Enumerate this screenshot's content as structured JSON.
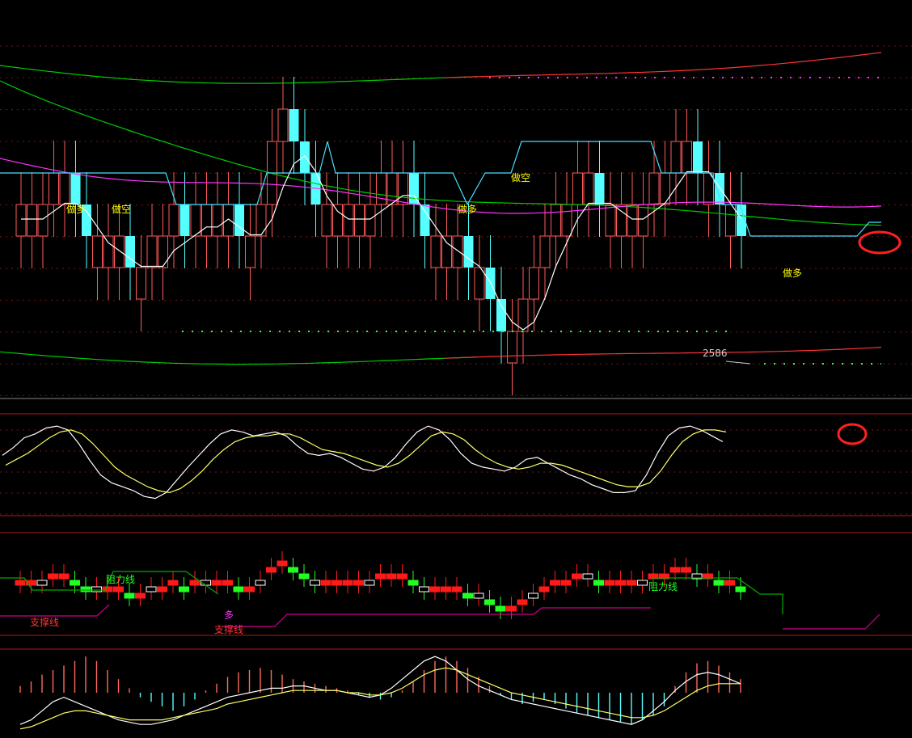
{
  "chart_data": [
    {
      "type": "candlestick",
      "panel": "main",
      "colors": {
        "up": "#ff5a5a",
        "down": "#55ffff",
        "upper_band_1": "#00cc00",
        "upper_band_2": "#ff3333",
        "mid_band": "#00cc00",
        "ma_magenta": "#ff33ff",
        "ma_white": "#ffffff",
        "resistance_stair": "#44e0ff",
        "dotted": "#ff33ff"
      },
      "annotations": [
        {
          "text": "做多",
          "x_index": 3
        },
        {
          "text": "做空",
          "x_index": 5
        },
        {
          "text": "做多",
          "x_index": 22
        },
        {
          "text": "做空",
          "x_index": 25
        },
        {
          "text": "做多",
          "x_index": 38
        }
      ],
      "low_label": "2586",
      "highlight_circle": "latest bar"
    },
    {
      "type": "line",
      "panel": "oscillator",
      "series": [
        {
          "color": "#ffffff",
          "values": [
            60,
            68,
            78,
            82,
            88,
            90,
            86,
            72,
            55,
            40,
            32,
            28,
            24,
            18,
            16,
            22,
            35,
            48,
            60,
            72,
            82,
            86,
            84,
            80,
            82,
            84,
            80,
            70,
            62,
            60,
            62,
            58,
            52,
            46,
            44,
            48,
            58,
            72,
            84,
            90,
            86,
            76,
            62,
            52,
            48,
            46,
            44,
            48,
            56,
            58,
            52,
            46,
            40,
            36,
            30,
            26,
            22,
            22,
            24,
            40,
            62,
            80,
            88,
            90,
            86,
            80,
            74
          ]
        },
        {
          "color": "#ffff66",
          "values": [
            50,
            56,
            62,
            70,
            78,
            84,
            86,
            82,
            72,
            60,
            48,
            40,
            34,
            28,
            24,
            22,
            26,
            34,
            44,
            56,
            66,
            74,
            78,
            80,
            80,
            82,
            82,
            78,
            72,
            66,
            64,
            62,
            58,
            54,
            50,
            48,
            52,
            60,
            70,
            80,
            84,
            82,
            76,
            66,
            58,
            52,
            48,
            46,
            48,
            52,
            52,
            50,
            46,
            42,
            38,
            34,
            30,
            28,
            28,
            32,
            44,
            60,
            74,
            82,
            86,
            86,
            84
          ]
        }
      ]
    },
    {
      "type": "bar",
      "panel": "strip",
      "labels": [
        "阻力线",
        "支撑线",
        "多",
        "支撑线",
        "阻力线"
      ]
    },
    {
      "type": "bar",
      "panel": "histogram",
      "values": [
        3,
        5,
        8,
        10,
        12,
        14,
        16,
        14,
        10,
        6,
        2,
        -2,
        -4,
        -6,
        -8,
        -6,
        -3,
        1,
        4,
        7,
        9,
        10,
        11,
        10,
        8,
        6,
        5,
        4,
        3,
        2,
        1,
        -1,
        -2,
        -3,
        -2,
        1,
        5,
        10,
        14,
        16,
        14,
        11,
        7,
        3,
        -1,
        -3,
        -5,
        -4,
        -3,
        -5,
        -7,
        -9,
        -10,
        -11,
        -12,
        -13,
        -14,
        -12,
        -10,
        -6,
        3,
        9,
        13,
        14,
        12,
        9,
        6
      ],
      "lines": [
        {
          "color": "#ffffff",
          "values": [
            -14,
            -12,
            -8,
            -4,
            -2,
            -4,
            -6,
            -8,
            -10,
            -12,
            -13,
            -14,
            -14,
            -13,
            -12,
            -10,
            -8,
            -6,
            -4,
            -2,
            -1,
            0,
            1,
            2,
            2,
            3,
            3,
            2,
            1,
            1,
            0,
            -1,
            -2,
            -1,
            2,
            6,
            10,
            14,
            16,
            14,
            10,
            6,
            3,
            1,
            -1,
            -3,
            -4,
            -5,
            -6,
            -7,
            -8,
            -9,
            -10,
            -11,
            -12,
            -13,
            -14,
            -12,
            -8,
            -4,
            1,
            5,
            8,
            9,
            8,
            6,
            4
          ]
        },
        {
          "color": "#ffff66",
          "values": [
            -16,
            -15,
            -13,
            -11,
            -9,
            -8,
            -8,
            -9,
            -10,
            -11,
            -12,
            -12,
            -12,
            -12,
            -11,
            -10,
            -9,
            -8,
            -7,
            -5,
            -4,
            -3,
            -2,
            -1,
            0,
            1,
            1,
            1,
            1,
            1,
            0,
            0,
            -1,
            -1,
            0,
            2,
            5,
            8,
            10,
            11,
            10,
            8,
            6,
            4,
            2,
            0,
            -1,
            -2,
            -3,
            -4,
            -5,
            -6,
            -7,
            -8,
            -9,
            -10,
            -11,
            -11,
            -10,
            -8,
            -5,
            -2,
            1,
            3,
            4,
            4,
            4
          ]
        }
      ]
    }
  ]
}
